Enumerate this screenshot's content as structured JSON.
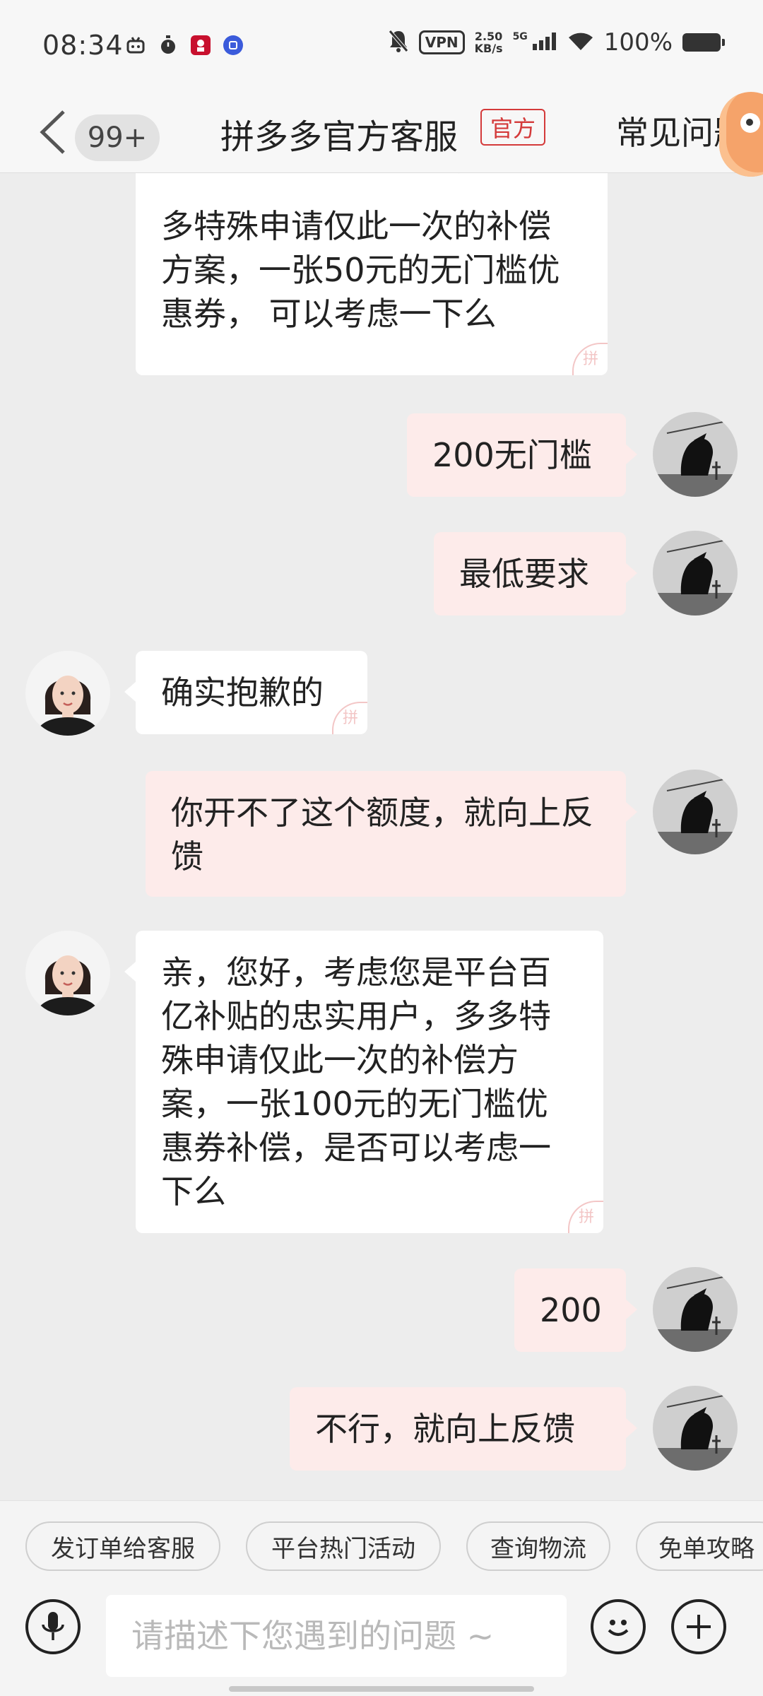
{
  "status_bar": {
    "time": "08:34",
    "app_icons": [
      "bilibili-icon",
      "timer-icon",
      "kfc-icon",
      "tieba-icon"
    ],
    "vpn": "VPN",
    "speed_value": "2.50",
    "speed_unit": "KB/s",
    "network": "5G",
    "battery": "100%"
  },
  "header": {
    "unread": "99+",
    "title": "拼多多官方客服",
    "official_badge": "官方",
    "faq": "常见问题"
  },
  "messages": [
    {
      "from": "agent",
      "text": "多特殊申请仅此一次的补偿方案，一张50元的无门槛优惠券， 可以考虑一下么",
      "watermark": "拼"
    },
    {
      "from": "user",
      "text": "200无门槛"
    },
    {
      "from": "user",
      "text": "最低要求"
    },
    {
      "from": "agent",
      "text": "确实抱歉的",
      "watermark": "拼"
    },
    {
      "from": "user",
      "text": "你开不了这个额度，就向上反馈"
    },
    {
      "from": "agent",
      "text": "亲，您好，考虑您是平台百亿补贴的忠实用户，多多特殊申请仅此一次的补偿方案，一张100元的无门槛优惠券补偿，是否可以考虑一下么",
      "watermark": "拼"
    },
    {
      "from": "user",
      "text": "200"
    },
    {
      "from": "user",
      "text": "不行，就向上反馈"
    }
  ],
  "quick_replies": [
    "发订单给客服",
    "平台热门活动",
    "查询物流",
    "免单攻略"
  ],
  "input": {
    "placeholder": "请描述下您遇到的问题 ~"
  },
  "colors": {
    "outgoing_bubble": "#fdebea",
    "incoming_bubble": "#ffffff",
    "official_red": "#d43a3a",
    "background": "#ededed"
  }
}
